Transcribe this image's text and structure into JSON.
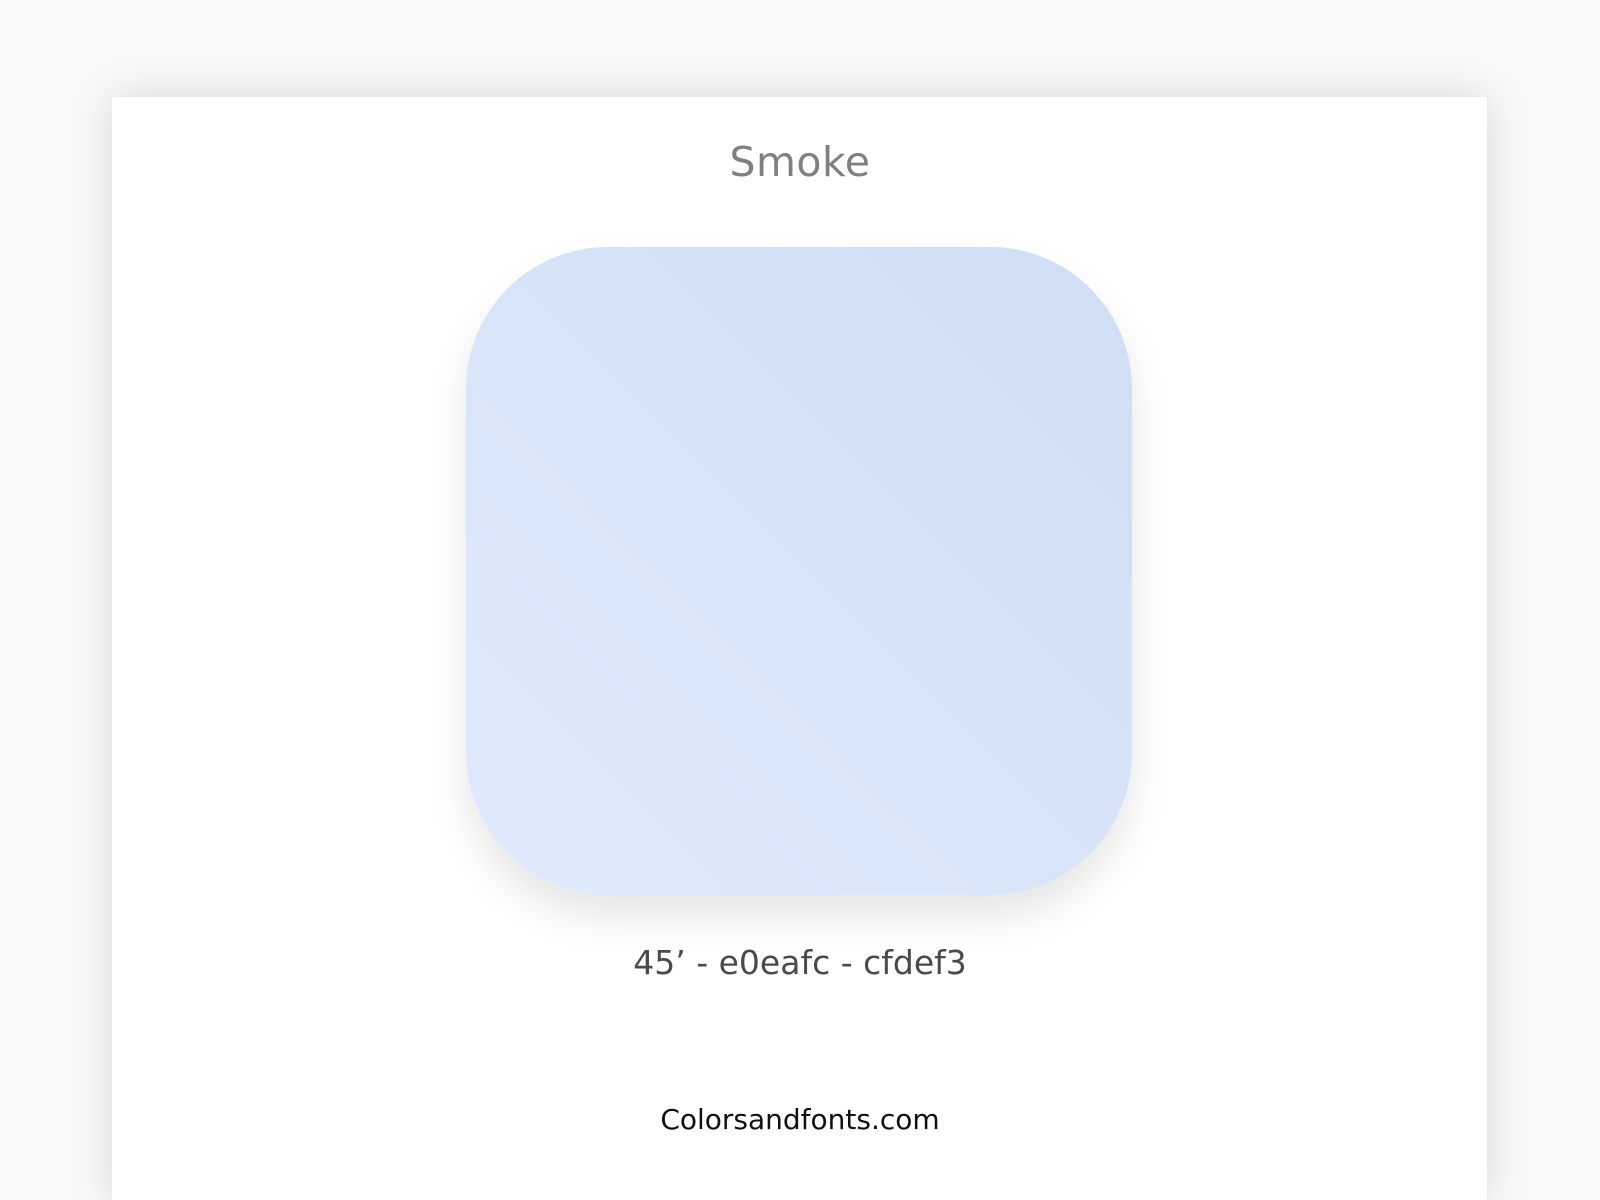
{
  "title": "Smoke",
  "gradient": {
    "angle_label": "45’",
    "angle_deg": 45,
    "color_start": "#e0eafc",
    "color_end": "#cfdef3",
    "caption": "45’ - e0eafc - cfdef3"
  },
  "footer": {
    "site": "Colorsandfonts.com"
  },
  "colors": {
    "background": "#f9f9f9",
    "card": "#ffffff",
    "title": "#808080",
    "caption": "#4a4a4a",
    "footer": "#111111"
  }
}
